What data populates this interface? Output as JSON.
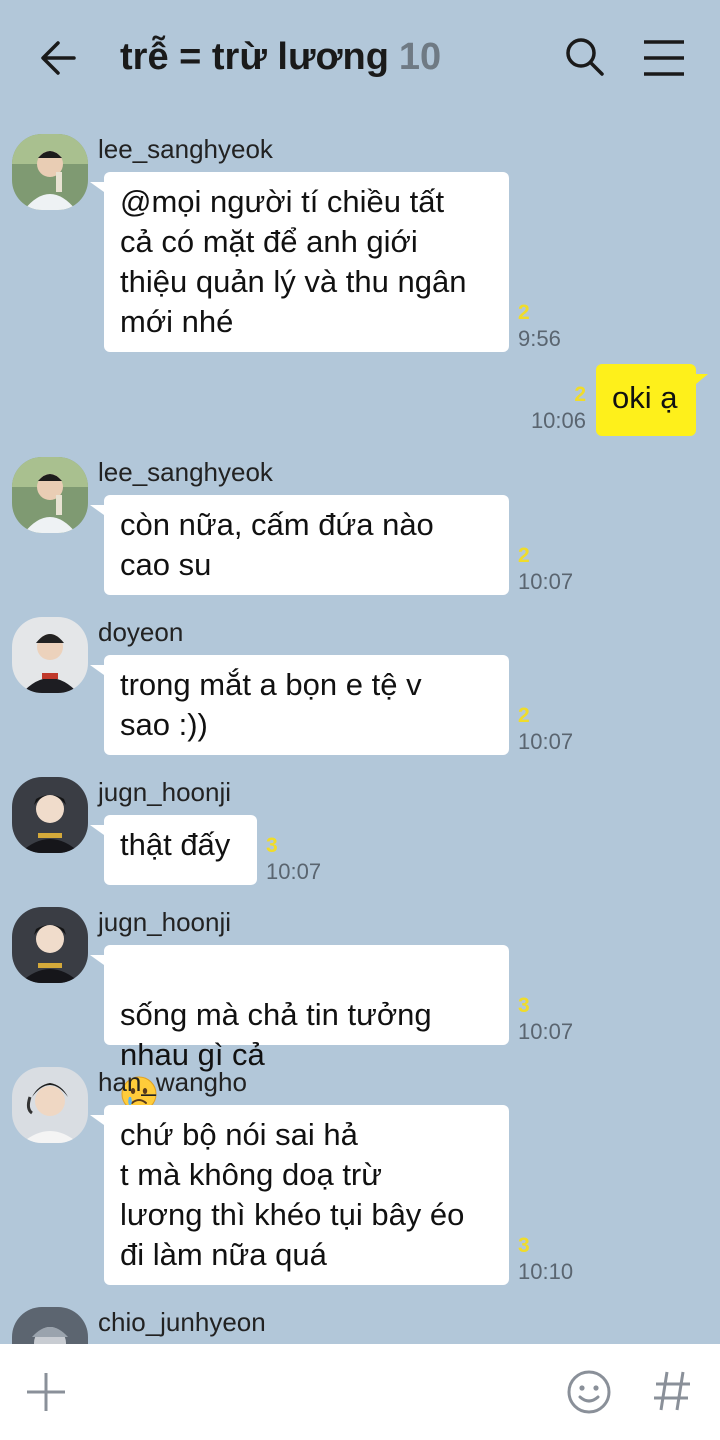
{
  "header": {
    "title": "trễ = trừ lương",
    "member_count": "10"
  },
  "messages": [
    {
      "sender": "lee_sanghyeok",
      "text": "@mọi người tí chiều tất\ncả có mặt để anh giới\nthiệu quản lý và thu ngân\nmới nhé",
      "unread": "2",
      "time": "9:56",
      "avatar": "user-photo-1"
    },
    {
      "sender": "",
      "text": "oki ạ",
      "unread": "2",
      "time": "10:06",
      "mine": true
    },
    {
      "sender": "lee_sanghyeok",
      "text": "còn nữa, cấm đứa nào\ncao su",
      "unread": "2",
      "time": "10:07",
      "avatar": "user-photo-1"
    },
    {
      "sender": "doyeon",
      "text": "trong mắt a bọn e tệ v\nsao :))",
      "unread": "2",
      "time": "10:07",
      "avatar": "user-photo-2"
    },
    {
      "sender": "jugn_hoonji",
      "text": "thật đấy",
      "unread": "3",
      "time": "10:07",
      "avatar": "user-photo-3"
    },
    {
      "sender": "jugn_hoonji",
      "text": "sống mà chả tin tưởng\nnhau gì cả",
      "emoji": "sad-face-emoji",
      "unread": "3",
      "time": "10:07",
      "avatar": "user-photo-3"
    },
    {
      "sender": "han_wangho",
      "text": "chứ bộ nói sai hả\nt mà không doạ trừ\nlương thì khéo tụi bây éo\nđi làm nữa quá",
      "unread": "3",
      "time": "10:10",
      "avatar": "user-photo-4"
    },
    {
      "sender": "chio_junhyeon",
      "avatar": "user-photo-5"
    }
  ],
  "icons": {
    "back": "arrow-left-icon",
    "search": "search-icon",
    "menu": "hamburger-menu-icon",
    "add": "plus-icon",
    "emoticon": "smiley-icon",
    "hashtag": "hashtag-icon"
  },
  "colors": {
    "background": "#b2c7d9",
    "my_bubble": "#fef01b",
    "their_bubble": "#ffffff",
    "unread_count": "#f0dc2a"
  }
}
